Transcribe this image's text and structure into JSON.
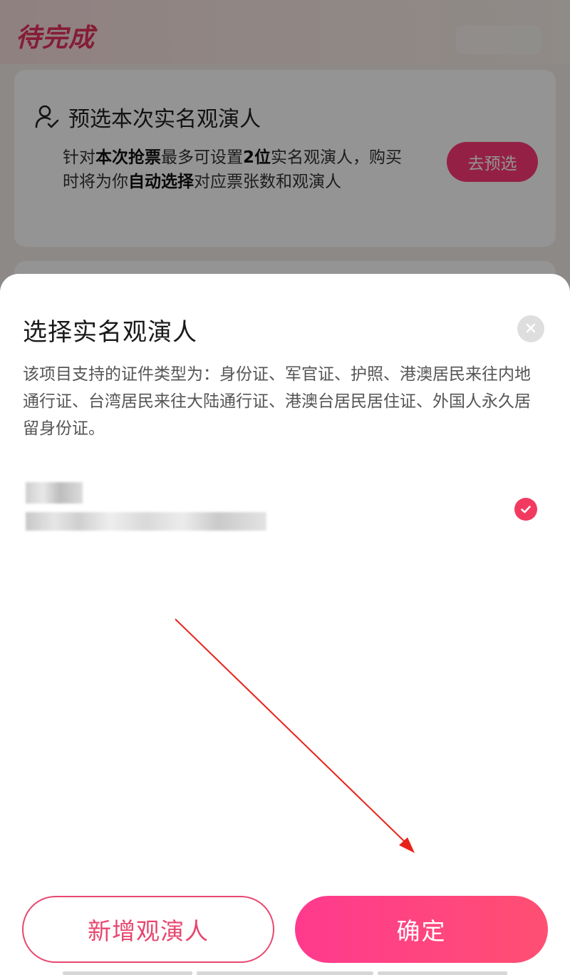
{
  "background": {
    "section_title": "待完成",
    "card": {
      "icon": "user-check-icon",
      "title": "预选本次实名观演人",
      "description_parts": [
        {
          "text": "针对",
          "bold": false
        },
        {
          "text": "本次抢票",
          "bold": true
        },
        {
          "text": "最多可设置",
          "bold": false
        },
        {
          "text": "2位",
          "bold": true
        },
        {
          "text": "实名观演人，购买时将为你",
          "bold": false
        },
        {
          "text": "自动选择",
          "bold": true
        },
        {
          "text": "对应票张数和观演人",
          "bold": false
        }
      ],
      "preselect_label": "去预选"
    }
  },
  "sheet": {
    "title": "选择实名观演人",
    "close_icon": "close-icon",
    "description": "该项目支持的证件类型为：身份证、军官证、护照、港澳居民来往内地通行证、台湾居民来往大陆通行证、港澳台居民居住证、外国人永久居留身份证。",
    "attendees": [
      {
        "name_redacted": true,
        "id_redacted": true,
        "selected": true
      }
    ],
    "add_label": "新增观演人",
    "confirm_label": "确定"
  },
  "colors": {
    "accent": "#f23a60",
    "brand_pink": "#e5315c",
    "confirm_gradient_start": "#ff3a8e",
    "confirm_gradient_end": "#ff4f72",
    "annotation_arrow": "#e8231c"
  }
}
